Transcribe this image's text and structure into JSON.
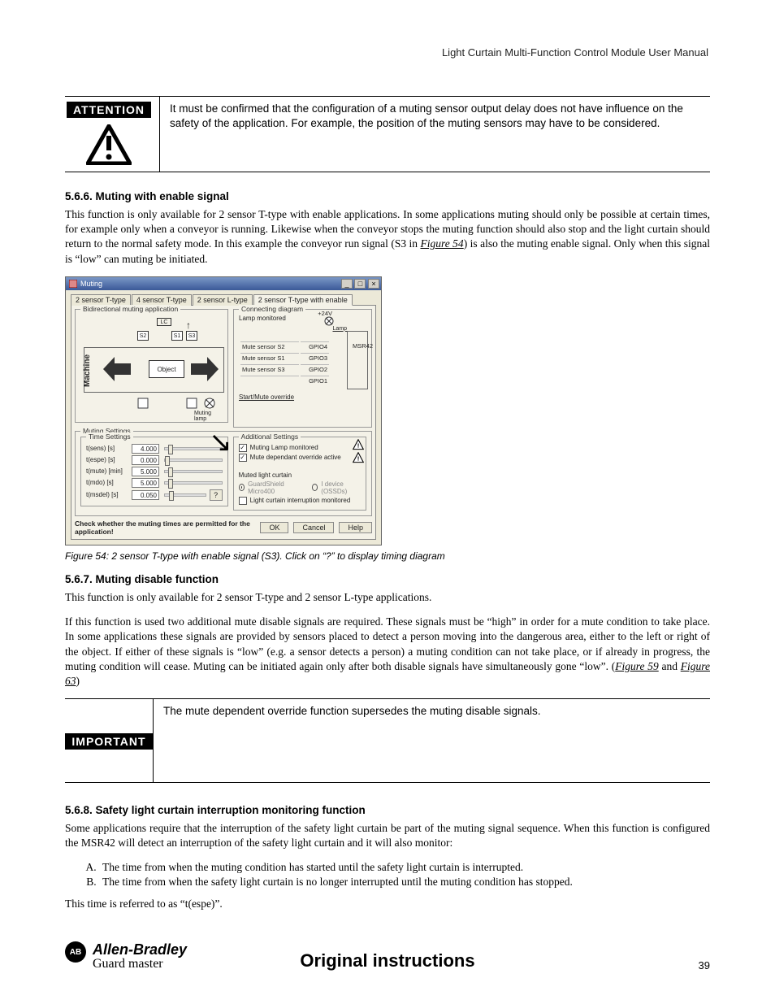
{
  "header": {
    "running_head": "Light Curtain Multi-Function Control Module User Manual"
  },
  "attention": {
    "label": "ATTENTION",
    "text": "It must be confirmed that the configuration of a muting sensor output delay does not have influence on the safety of the application. For example, the position of the muting sensors may have to be considered."
  },
  "sec566": {
    "heading": "5.6.6.  Muting with enable signal",
    "p1a": "This function is only available for 2 sensor T-type with enable applications. In some applications muting should only be possible at certain times, for example only when a conveyor is running. Likewise when the conveyor stops the muting function should also stop and the light curtain should return to the normal safety mode. In this example the conveyor run signal (S3 in ",
    "fig_ref": "Figure 54",
    "p1b": ") is also the muting enable signal. Only when this signal is “low” can muting be initiated."
  },
  "dialog": {
    "title": "Muting",
    "tabs": [
      "2 sensor T-type",
      "4 sensor T-type",
      "2 sensor L-type",
      "2 sensor T-type with enable"
    ],
    "active_tab": 3,
    "group_bidir": "Bidirectional muting application",
    "lc": "LC",
    "s1": "S1",
    "s2": "S2",
    "s3": "S3",
    "machine": "Machine",
    "object": "Object",
    "muting_lamp": "Muting lamp",
    "group_conn": "Connecting diagram",
    "lamp_monitored": "Lamp monitored",
    "v24": "+24V",
    "lamp": "Lamp",
    "rows": [
      {
        "l": "Mute sensor S2",
        "r": "GPIO4"
      },
      {
        "l": "Mute sensor S1",
        "r": "GPIO3"
      },
      {
        "l": "Mute sensor S3",
        "r": "GPIO2"
      },
      {
        "l": "",
        "r": "GPIO1"
      }
    ],
    "msr": "MSR42",
    "start_override": "Start/Mute override",
    "group_muting": "Muting Settings",
    "group_time": "Time Settings",
    "group_add": "Additional Settings",
    "times": [
      {
        "lbl": "t(sens) [s]",
        "val": "4.000",
        "pos": 6
      },
      {
        "lbl": "t(espe) [s]",
        "val": "0.000",
        "pos": 0
      },
      {
        "lbl": "t(mute) [min]",
        "val": "5.000",
        "pos": 6
      },
      {
        "lbl": "t(mdo) [s]",
        "val": "5.000",
        "pos": 6
      },
      {
        "lbl": "t(msdel) [s]",
        "val": "0.050",
        "pos": 10
      }
    ],
    "q": "?",
    "chk_lamp": "Muting Lamp monitored",
    "chk_override": "Mute dependant override active",
    "muted_lc": "Muted light curtain",
    "radio1": "GuardShield Micro400",
    "radio2": "I device (OSSDs)",
    "chk_int": "Light curtain interruption monitored",
    "warn_note": "Check whether the muting times are permitted for the application!",
    "ok": "OK",
    "cancel": "Cancel",
    "help": "Help"
  },
  "caption": "Figure 54: 2 sensor T-type with enable signal (S3). Click on “?” to display timing diagram",
  "sec567": {
    "heading": "5.6.7.  Muting disable function",
    "p1": "This function is only available for 2 sensor T-type and 2 sensor L-type applications.",
    "p2a": "If this function is used two additional mute disable signals are required. These signals must be “high” in order for a mute condition to take place. In some applications these signals are provided by sensors placed to detect a person moving into the dangerous area, either to the left or right of the object. If either of these signals is “low” (e.g. a sensor detects a person) a muting condition can not take place, or if already in progress, the muting condition will cease. Muting can be initiated again only after both disable signals have simultaneously gone “low”. (",
    "fig59": "Figure 59",
    "and": " and ",
    "fig63": "Figure 63",
    "p2b": ")"
  },
  "important": {
    "label": "IMPORTANT",
    "text": "The mute dependent override function supersedes the muting disable signals."
  },
  "sec568": {
    "heading": "5.6.8.  Safety light curtain interruption monitoring function",
    "p1": "Some applications require that the interruption of the safety light curtain be part of the muting signal sequence. When this function is configured the MSR42 will detect an interruption of the safety light curtain and it will also monitor:",
    "liA": "The time from when the muting condition has started until the safety light curtain is interrupted.",
    "liB": "The time from when the safety light curtain is no longer interrupted until the muting condition has stopped.",
    "p2": "This time is referred to as “t(espe)”."
  },
  "footer": {
    "brand1": "Allen-Bradley",
    "brand2": "Guard  master",
    "center": "Original instructions",
    "page": "39"
  }
}
